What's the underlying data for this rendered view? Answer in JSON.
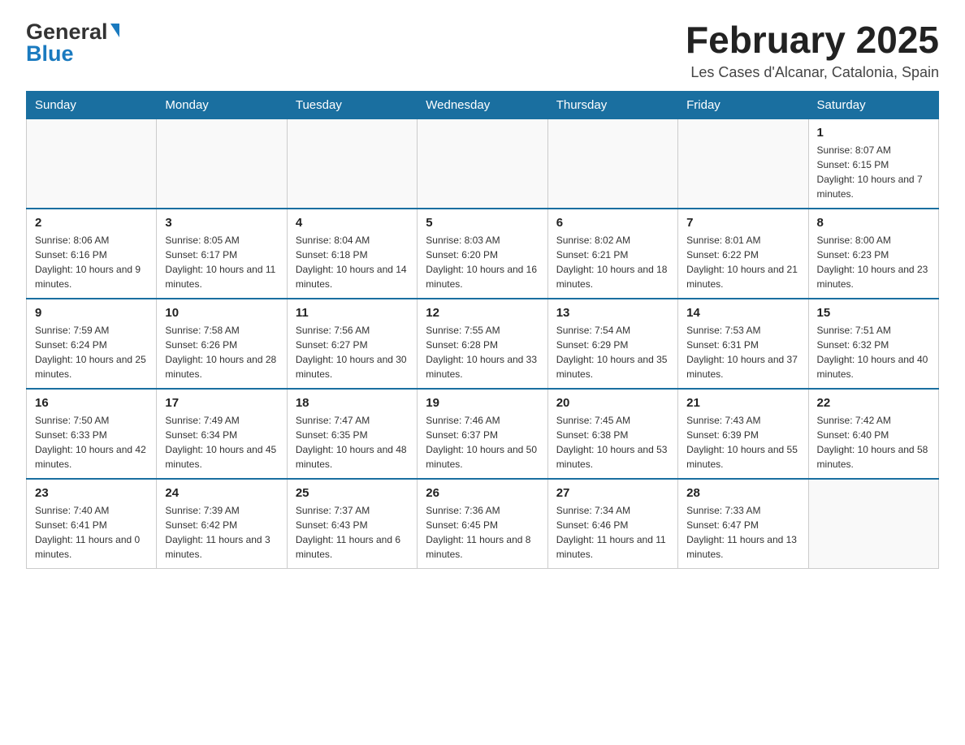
{
  "logo": {
    "text_general": "General",
    "text_blue": "Blue"
  },
  "header": {
    "month": "February 2025",
    "location": "Les Cases d'Alcanar, Catalonia, Spain"
  },
  "weekdays": [
    "Sunday",
    "Monday",
    "Tuesday",
    "Wednesday",
    "Thursday",
    "Friday",
    "Saturday"
  ],
  "weeks": [
    [
      {
        "day": "",
        "info": ""
      },
      {
        "day": "",
        "info": ""
      },
      {
        "day": "",
        "info": ""
      },
      {
        "day": "",
        "info": ""
      },
      {
        "day": "",
        "info": ""
      },
      {
        "day": "",
        "info": ""
      },
      {
        "day": "1",
        "info": "Sunrise: 8:07 AM\nSunset: 6:15 PM\nDaylight: 10 hours and 7 minutes."
      }
    ],
    [
      {
        "day": "2",
        "info": "Sunrise: 8:06 AM\nSunset: 6:16 PM\nDaylight: 10 hours and 9 minutes."
      },
      {
        "day": "3",
        "info": "Sunrise: 8:05 AM\nSunset: 6:17 PM\nDaylight: 10 hours and 11 minutes."
      },
      {
        "day": "4",
        "info": "Sunrise: 8:04 AM\nSunset: 6:18 PM\nDaylight: 10 hours and 14 minutes."
      },
      {
        "day": "5",
        "info": "Sunrise: 8:03 AM\nSunset: 6:20 PM\nDaylight: 10 hours and 16 minutes."
      },
      {
        "day": "6",
        "info": "Sunrise: 8:02 AM\nSunset: 6:21 PM\nDaylight: 10 hours and 18 minutes."
      },
      {
        "day": "7",
        "info": "Sunrise: 8:01 AM\nSunset: 6:22 PM\nDaylight: 10 hours and 21 minutes."
      },
      {
        "day": "8",
        "info": "Sunrise: 8:00 AM\nSunset: 6:23 PM\nDaylight: 10 hours and 23 minutes."
      }
    ],
    [
      {
        "day": "9",
        "info": "Sunrise: 7:59 AM\nSunset: 6:24 PM\nDaylight: 10 hours and 25 minutes."
      },
      {
        "day": "10",
        "info": "Sunrise: 7:58 AM\nSunset: 6:26 PM\nDaylight: 10 hours and 28 minutes."
      },
      {
        "day": "11",
        "info": "Sunrise: 7:56 AM\nSunset: 6:27 PM\nDaylight: 10 hours and 30 minutes."
      },
      {
        "day": "12",
        "info": "Sunrise: 7:55 AM\nSunset: 6:28 PM\nDaylight: 10 hours and 33 minutes."
      },
      {
        "day": "13",
        "info": "Sunrise: 7:54 AM\nSunset: 6:29 PM\nDaylight: 10 hours and 35 minutes."
      },
      {
        "day": "14",
        "info": "Sunrise: 7:53 AM\nSunset: 6:31 PM\nDaylight: 10 hours and 37 minutes."
      },
      {
        "day": "15",
        "info": "Sunrise: 7:51 AM\nSunset: 6:32 PM\nDaylight: 10 hours and 40 minutes."
      }
    ],
    [
      {
        "day": "16",
        "info": "Sunrise: 7:50 AM\nSunset: 6:33 PM\nDaylight: 10 hours and 42 minutes."
      },
      {
        "day": "17",
        "info": "Sunrise: 7:49 AM\nSunset: 6:34 PM\nDaylight: 10 hours and 45 minutes."
      },
      {
        "day": "18",
        "info": "Sunrise: 7:47 AM\nSunset: 6:35 PM\nDaylight: 10 hours and 48 minutes."
      },
      {
        "day": "19",
        "info": "Sunrise: 7:46 AM\nSunset: 6:37 PM\nDaylight: 10 hours and 50 minutes."
      },
      {
        "day": "20",
        "info": "Sunrise: 7:45 AM\nSunset: 6:38 PM\nDaylight: 10 hours and 53 minutes."
      },
      {
        "day": "21",
        "info": "Sunrise: 7:43 AM\nSunset: 6:39 PM\nDaylight: 10 hours and 55 minutes."
      },
      {
        "day": "22",
        "info": "Sunrise: 7:42 AM\nSunset: 6:40 PM\nDaylight: 10 hours and 58 minutes."
      }
    ],
    [
      {
        "day": "23",
        "info": "Sunrise: 7:40 AM\nSunset: 6:41 PM\nDaylight: 11 hours and 0 minutes."
      },
      {
        "day": "24",
        "info": "Sunrise: 7:39 AM\nSunset: 6:42 PM\nDaylight: 11 hours and 3 minutes."
      },
      {
        "day": "25",
        "info": "Sunrise: 7:37 AM\nSunset: 6:43 PM\nDaylight: 11 hours and 6 minutes."
      },
      {
        "day": "26",
        "info": "Sunrise: 7:36 AM\nSunset: 6:45 PM\nDaylight: 11 hours and 8 minutes."
      },
      {
        "day": "27",
        "info": "Sunrise: 7:34 AM\nSunset: 6:46 PM\nDaylight: 11 hours and 11 minutes."
      },
      {
        "day": "28",
        "info": "Sunrise: 7:33 AM\nSunset: 6:47 PM\nDaylight: 11 hours and 13 minutes."
      },
      {
        "day": "",
        "info": ""
      }
    ]
  ]
}
